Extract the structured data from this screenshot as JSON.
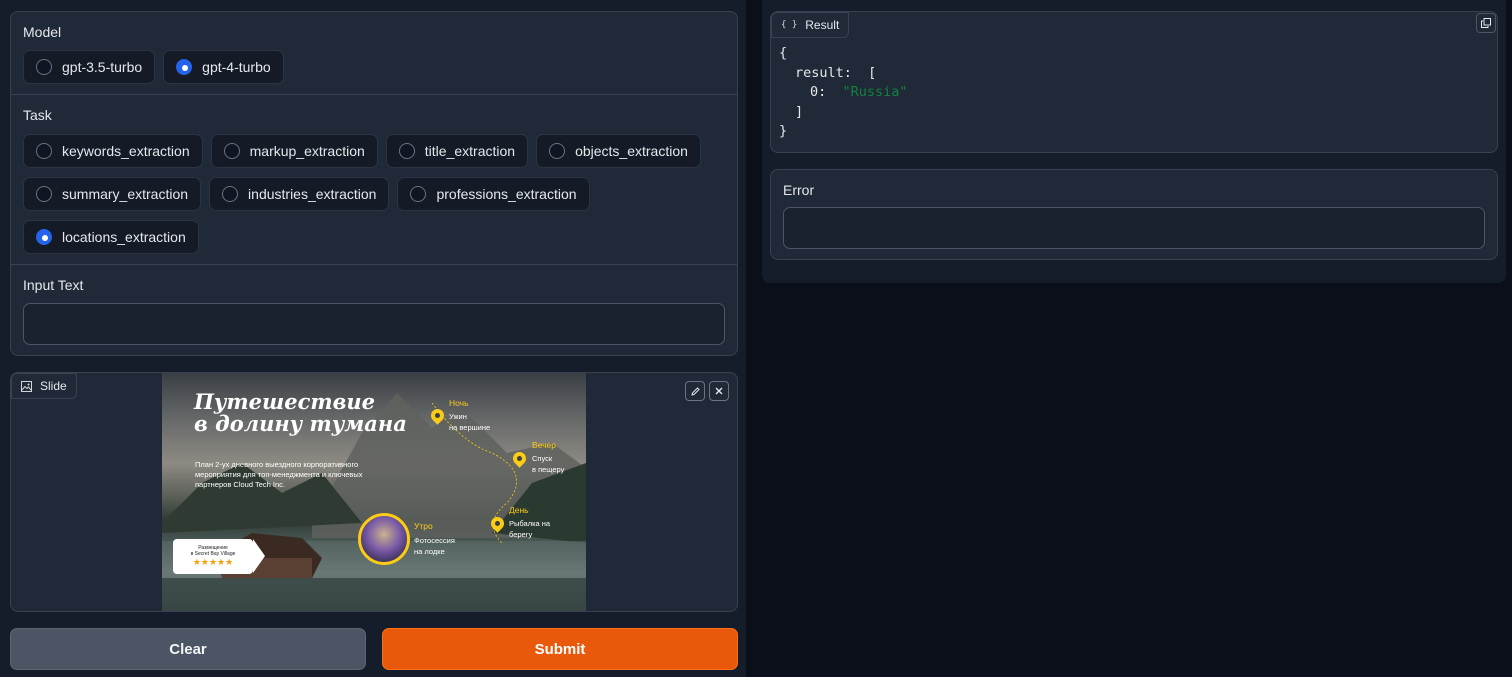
{
  "model": {
    "label": "Model",
    "options": [
      "gpt-3.5-turbo",
      "gpt-4-turbo"
    ],
    "selected": "gpt-4-turbo"
  },
  "task": {
    "label": "Task",
    "options": [
      "keywords_extraction",
      "markup_extraction",
      "title_extraction",
      "objects_extraction",
      "summary_extraction",
      "industries_extraction",
      "professions_extraction",
      "locations_extraction"
    ],
    "selected": "locations_extraction"
  },
  "input_text": {
    "label": "Input Text",
    "value": ""
  },
  "slide": {
    "label": "Slide",
    "image": {
      "title_line1": "Путешествие",
      "title_line2": "в долину тумана",
      "description": "План 2-ух дневного выездного корпоративного мероприятия для топ-менеджмента и ключевых партнеров Cloud Tech Inc.",
      "card_line1": "Размещение",
      "card_line2": "в Secret Bay Village",
      "card_stars": "★★★★★",
      "stops": [
        {
          "label": "Ночь",
          "text1": "Ужин",
          "text2": "на вершине"
        },
        {
          "label": "Вечер",
          "text1": "Спуск",
          "text2": "в пещеру"
        },
        {
          "label": "День",
          "text1": "Рыбалка на",
          "text2": "берегу"
        },
        {
          "label": "Утро",
          "text1": "Фотосессия",
          "text2": "на лодке"
        }
      ]
    }
  },
  "buttons": {
    "clear": "Clear",
    "submit": "Submit"
  },
  "result": {
    "label": "Result",
    "lines": {
      "open": "{",
      "key": "result:",
      "bracket_open": "[",
      "index": "0:",
      "value": "\"Russia\"",
      "bracket_close": "]",
      "close": "}"
    }
  },
  "error": {
    "label": "Error",
    "value": ""
  },
  "colors": {
    "accent": "#ea580c",
    "radio_selected": "#2563eb",
    "json_string": "#15803d"
  }
}
